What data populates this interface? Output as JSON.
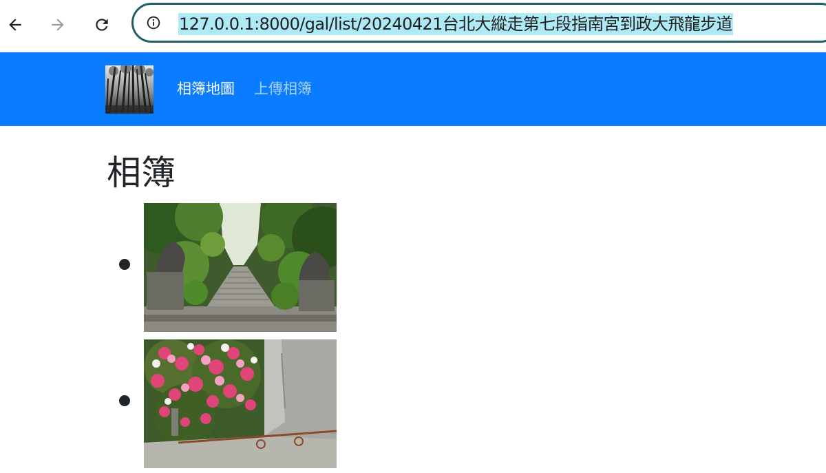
{
  "browser": {
    "url": "127.0.0.1:8000/gal/list/20240421台北大縱走第七段指南宮到政大飛龍步道",
    "icons": {
      "back": "arrow-left-icon",
      "forward": "arrow-right-icon",
      "reload": "reload-icon",
      "site_info": "info-icon"
    }
  },
  "navbar": {
    "brand_icon": "forest-logo",
    "links": [
      {
        "label": "相簿地圖",
        "active": true
      },
      {
        "label": "上傳相簿",
        "active": false
      }
    ],
    "colors": {
      "background": "#0a7cff",
      "active_link": "#ffffff",
      "muted_link": "#a9d0ff"
    }
  },
  "main": {
    "title": "相簿",
    "albums": [
      {
        "thumbnail": "stone-staircase-with-lion-statues-photo"
      },
      {
        "thumbnail": "pink-azalea-flowers-by-concrete-wall-photo"
      }
    ]
  }
}
